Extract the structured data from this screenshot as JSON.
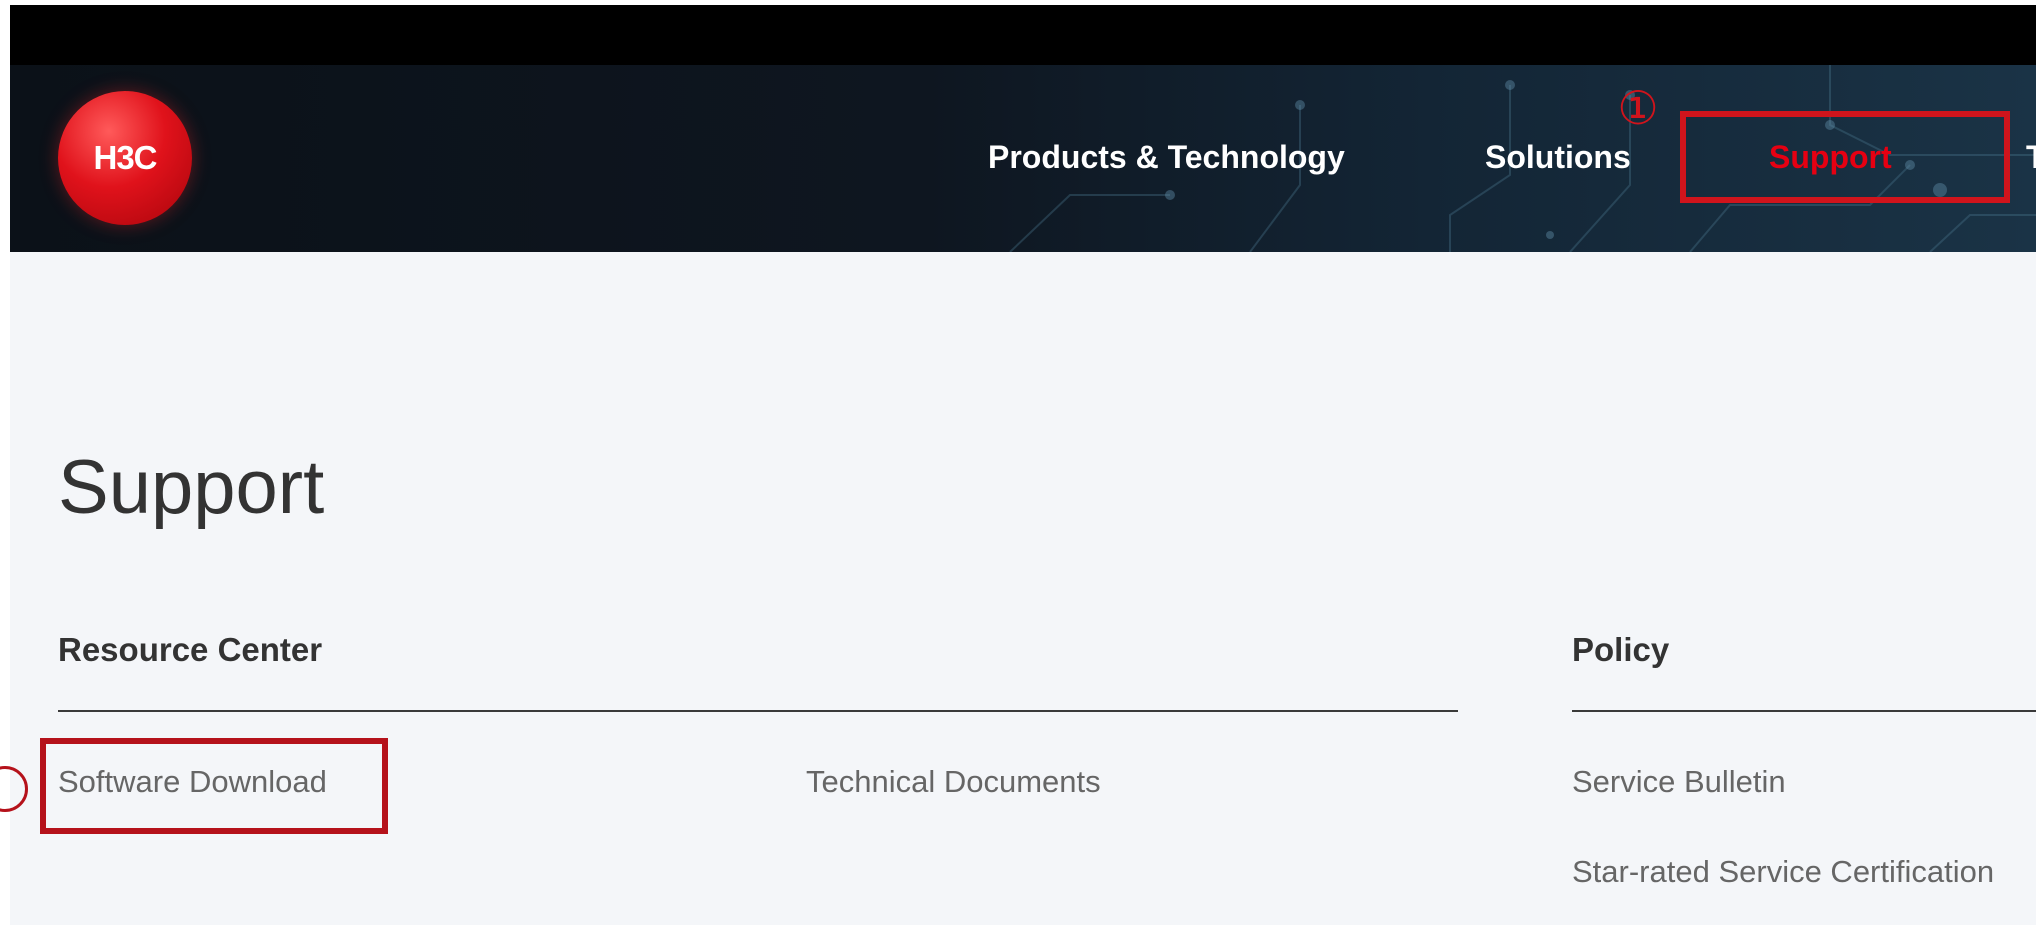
{
  "brand": {
    "logo_text": "H3C",
    "primary_color": "#e60012",
    "annotation_color": "#d0141c"
  },
  "nav": {
    "items": [
      {
        "label": "Products & Technology"
      },
      {
        "label": "Solutions"
      },
      {
        "label": "Support",
        "active": true
      },
      {
        "label": "T"
      }
    ]
  },
  "annotations": {
    "step1": "①"
  },
  "page": {
    "title": "Support"
  },
  "sections": {
    "resource_center": {
      "heading": "Resource Center",
      "links": [
        "Software Download",
        "Technical Documents"
      ]
    },
    "policy": {
      "heading": "Policy",
      "links": [
        "Service Bulletin",
        "Star-rated Service Certification"
      ]
    }
  }
}
